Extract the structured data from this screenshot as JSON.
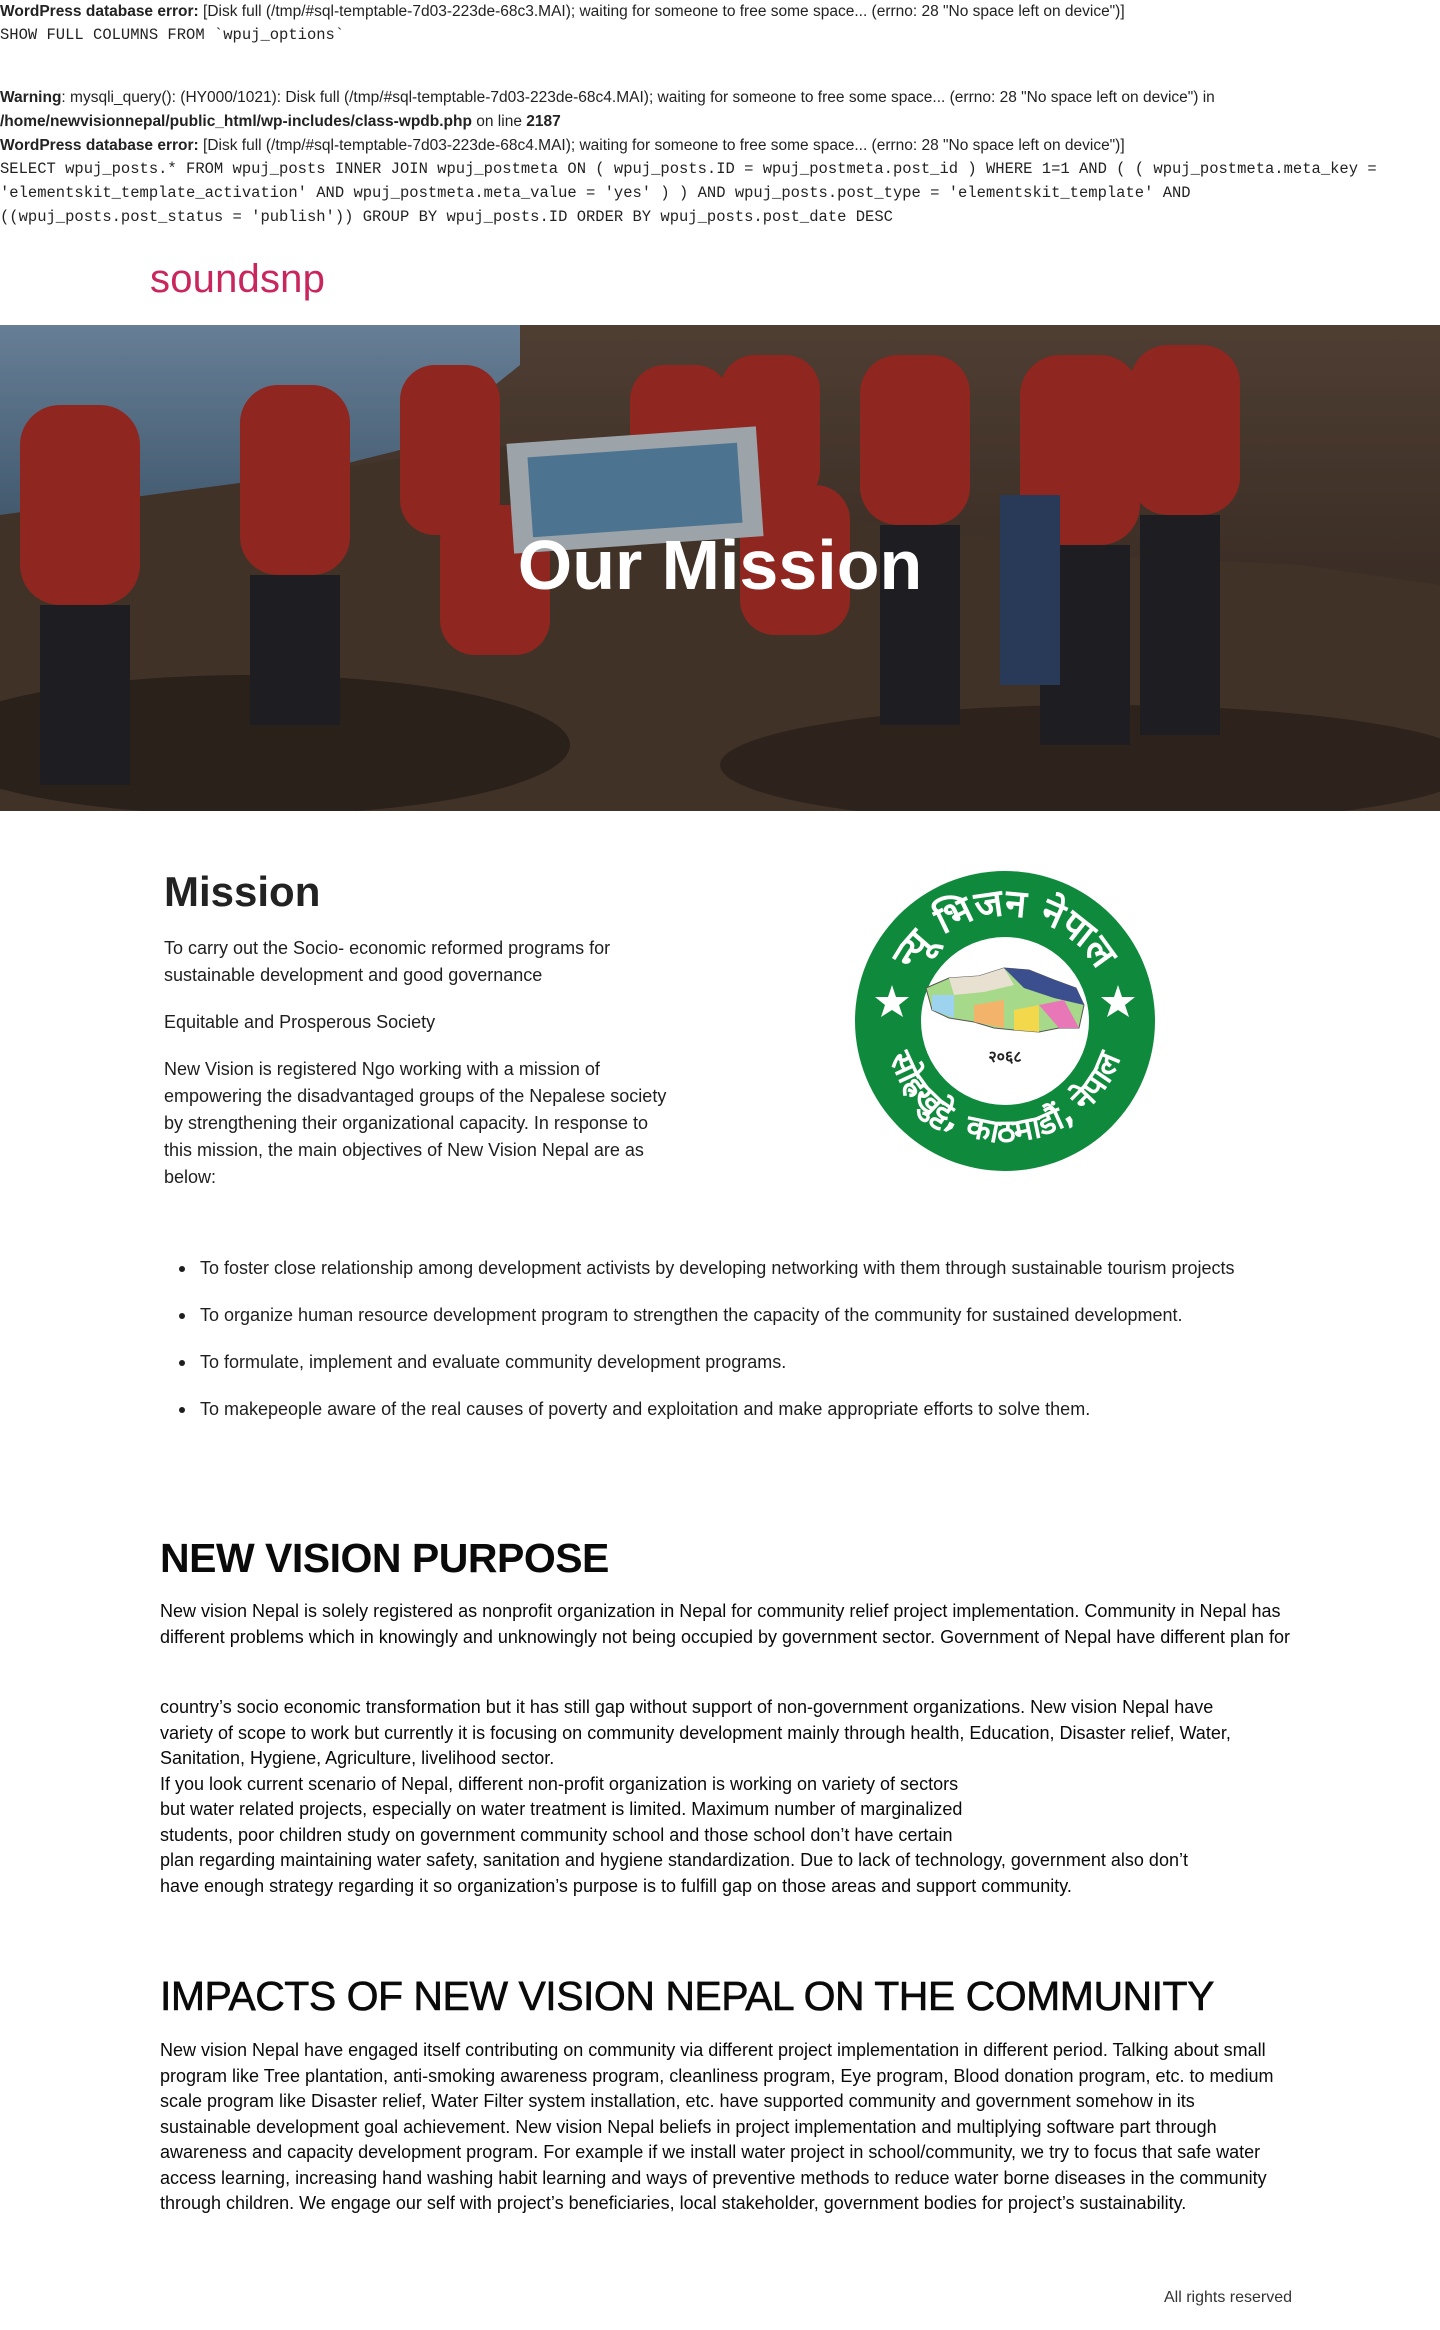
{
  "errors": {
    "line1_label": "WordPress database error:",
    "line1_text": " [Disk full (/tmp/#sql-temptable-7d03-223de-68c3.MAI); waiting for someone to free some space... (errno: 28 \"No space left on device\")]",
    "line2": "SHOW FULL COLUMNS FROM `wpuj_options`",
    "warning_label": "Warning",
    "warning_text": ": mysqli_query(): (HY000/1021): Disk full (/tmp/#sql-temptable-7d03-223de-68c4.MAI); waiting for someone to free some space... (errno: 28 \"No space left on device\") in",
    "warning_path": "/home/newvisionnepal/public_html/wp-includes/class-wpdb.php",
    "warning_online": " on line ",
    "warning_line": "2187",
    "line5_label": "WordPress database error:",
    "line5_text": " [Disk full (/tmp/#sql-temptable-7d03-223de-68c4.MAI); waiting for someone to free some space... (errno: 28 \"No space left on device\")]",
    "sql1": "SELECT wpuj_posts.* FROM wpuj_posts INNER JOIN wpuj_postmeta ON ( wpuj_posts.ID = wpuj_postmeta.post_id ) WHERE 1=1 AND ( ( wpuj_postmeta.meta_key =",
    "sql2": "'elementskit_template_activation' AND wpuj_postmeta.meta_value = 'yes' ) ) AND wpuj_posts.post_type = 'elementskit_template' AND",
    "sql3": "((wpuj_posts.post_status = 'publish')) GROUP BY wpuj_posts.ID ORDER BY wpuj_posts.post_date DESC"
  },
  "site": {
    "logo": "soundsnp"
  },
  "hero": {
    "title": "Our Mission"
  },
  "mission": {
    "heading": "Mission",
    "p1": "To carry out the Socio- economic reformed programs for sustainable development and good governance",
    "p2": "Equitable and Prosperous Society",
    "p3": "New Vision is registered Ngo working with a mission of empowering the disadvantaged groups of the Nepalese society by strengthening their organizational capacity. In response to this mission, the main objectives of New Vision Nepal are as below:"
  },
  "seal": {
    "top_text": "न्यू भिजन नेपाल",
    "bottom_text": "सोह्रखुट्टे, काठमाडौं, नेपाल",
    "year": "२०६८",
    "colors": {
      "ring": "#0f8a3c",
      "text": "#ffffff"
    }
  },
  "objectives": [
    "To foster close relationship among development activists by developing networking with them through sustainable tourism projects",
    "To organize human resource development program to strengthen the capacity of the community for sustained development.",
    "To formulate, implement and evaluate community development programs.",
    "To makepeople aware of the real causes of poverty and exploitation and make appropriate efforts to solve them."
  ],
  "purpose": {
    "heading": "NEW VISION PURPOSE",
    "p1": "New vision Nepal is solely registered as nonprofit organization in Nepal for community relief project implementation. Community in Nepal has different problems which in knowingly and unknowingly not being occupied by government sector. Government of Nepal have different plan for",
    "p2_lines": [
      "country’s socio economic transformation but it has still gap without support of non-government organizations. New vision Nepal have",
      "variety of scope to work but currently it is focusing on community development mainly through health, Education, Disaster relief, Water,",
      "Sanitation, Hygiene, Agriculture, livelihood sector.",
      "If you look current scenario of Nepal, different non-profit organization is working on variety of sectors",
      "but water related projects, especially on water treatment is limited. Maximum number of marginalized",
      "students, poor children study on government community school and those school don’t have certain",
      "plan regarding maintaining water safety, sanitation and hygiene standardization. Due to lack of technology, government also don’t",
      "have enough strategy regarding it so organization’s purpose is to fulfill gap on those areas and support community."
    ]
  },
  "impacts": {
    "heading": "IMPACTS OF NEW VISION NEPAL ON THE COMMUNITY",
    "p1": "New vision Nepal have engaged itself contributing on community via different project implementation in different period. Talking about small program like Tree plantation, anti-smoking awareness program, cleanliness program, Eye program, Blood donation program, etc. to medium scale program like Disaster relief, Water Filter system installation, etc. have supported community and government somehow in its sustainable development goal achievement. New vision Nepal beliefs in project implementation and multiplying software part through awareness and capacity development program. For example if we install water project in school/community, we try to focus that safe water access learning, increasing hand washing habit learning and ways of preventive methods to reduce water borne diseases in the community through children. We engage our self with project’s beneficiaries, local stakeholder, government bodies for project’s sustainability."
  },
  "footer": {
    "text": "All rights reserved"
  }
}
